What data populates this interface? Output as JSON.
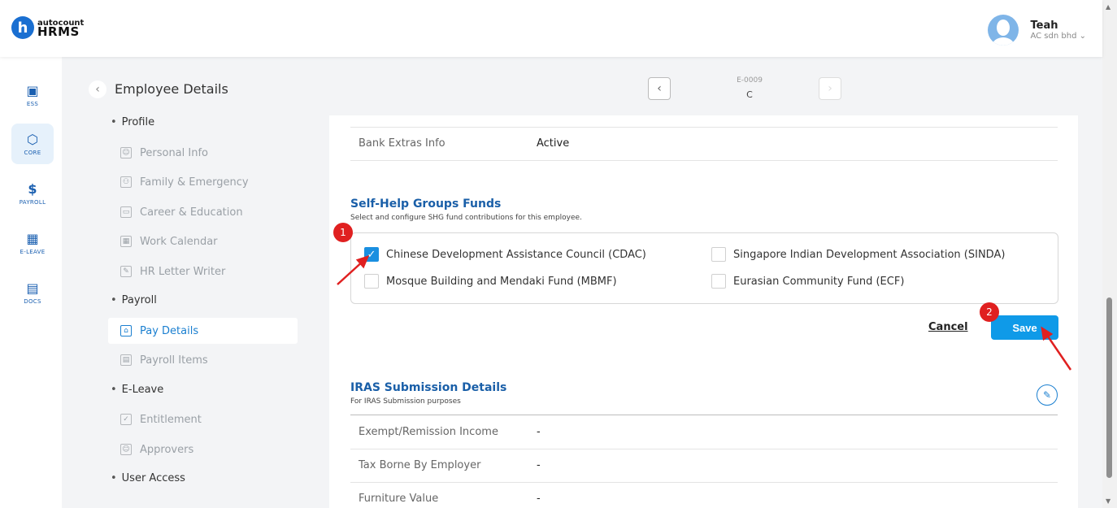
{
  "header": {
    "logo_letter": "h",
    "logo_small": "autocount",
    "logo_big": "HRMS",
    "user_name": "Teah",
    "company": "AC sdn bhd"
  },
  "rail": [
    {
      "label": "ESS",
      "icon": "id-card-icon",
      "glyph": "▣"
    },
    {
      "label": "CORE",
      "icon": "cube-icon",
      "glyph": "⬡"
    },
    {
      "label": "PAYROLL",
      "icon": "dollar-icon",
      "glyph": "$"
    },
    {
      "label": "E-LEAVE",
      "icon": "calendar-icon",
      "glyph": "▦"
    },
    {
      "label": "DOCS",
      "icon": "document-icon",
      "glyph": "▤"
    }
  ],
  "page": {
    "title": "Employee Details",
    "employee_id": "E-0009",
    "employee_name": "C"
  },
  "subnav": {
    "profile": "Profile",
    "personal_info": "Personal Info",
    "family": "Family & Emergency",
    "career": "Career & Education",
    "calendar": "Work Calendar",
    "letter": "HR Letter Writer",
    "payroll": "Payroll",
    "pay_details": "Pay Details",
    "payroll_items": "Payroll Items",
    "eleave": "E-Leave",
    "entitlement": "Entitlement",
    "approvers": "Approvers",
    "user_access": "User Access"
  },
  "bank": {
    "label": "Bank Extras Info",
    "value": "Active"
  },
  "shg": {
    "title": "Self-Help Groups Funds",
    "subtitle": "Select and configure SHG fund contributions for this employee.",
    "options": [
      {
        "label": "Chinese Development Assistance Council (CDAC)",
        "checked": true
      },
      {
        "label": "Singapore Indian Development Association (SINDA)",
        "checked": false
      },
      {
        "label": "Mosque Building and Mendaki Fund (MBMF)",
        "checked": false
      },
      {
        "label": "Eurasian Community Fund (ECF)",
        "checked": false
      }
    ],
    "cancel": "Cancel",
    "save": "Save"
  },
  "iras": {
    "title": "IRAS Submission Details",
    "subtitle": "For IRAS Submission purposes",
    "rows": [
      {
        "label": "Exempt/Remission Income",
        "value": "-"
      },
      {
        "label": "Tax Borne By Employer",
        "value": "-"
      },
      {
        "label": "Furniture Value",
        "value": "-"
      }
    ]
  },
  "annotations": {
    "step1": "1",
    "step2": "2",
    "color": "#e02020"
  }
}
